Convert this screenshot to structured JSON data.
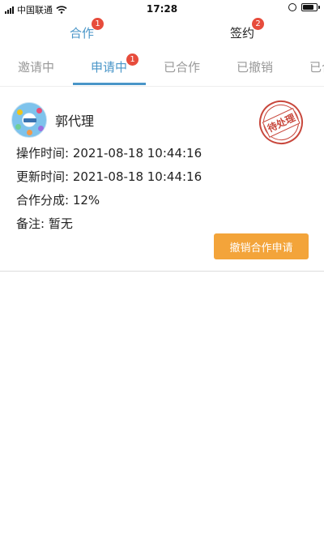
{
  "status_bar": {
    "carrier": "中国联通",
    "time": "17:28"
  },
  "top_tabs": [
    {
      "label": "合作",
      "badge": "1",
      "active": true
    },
    {
      "label": "签约",
      "badge": "2",
      "active": false
    }
  ],
  "sub_tabs": [
    {
      "label": "邀请中",
      "badge": ""
    },
    {
      "label": "申请中",
      "badge": "1",
      "active": true
    },
    {
      "label": "已合作",
      "badge": ""
    },
    {
      "label": "已撤销",
      "badge": ""
    },
    {
      "label": "已合",
      "badge": ""
    }
  ],
  "card": {
    "name": "郭代理",
    "operate_time": "操作时间: 2021-08-18 10:44:16",
    "update_time": "更新时间: 2021-08-18 10:44:16",
    "share": "合作分成: 12%",
    "remark": "备注: 暂无",
    "stamp": "待处理",
    "cancel_button": "撤销合作申请"
  },
  "colors": {
    "accent": "#4a96c8",
    "badge": "#e74c3c",
    "button": "#f3a43a",
    "stamp": "#c8473c"
  }
}
